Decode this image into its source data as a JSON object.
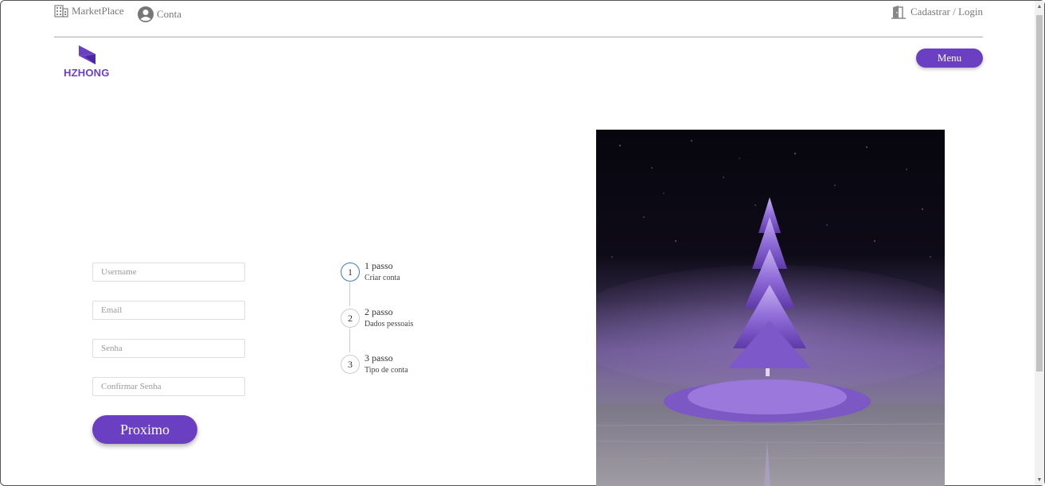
{
  "topbar": {
    "marketplace": "MarketPlace",
    "account": "Conta",
    "auth": "Cadastrar / Login"
  },
  "brand": {
    "name": "HZHONG",
    "color": "#6a3fc2"
  },
  "header": {
    "menu_label": "Menu"
  },
  "form": {
    "username_placeholder": "Username",
    "email_placeholder": "Email",
    "password_placeholder": "Senha",
    "confirm_placeholder": "Confirmar Senha",
    "next_label": "Proximo"
  },
  "steps": [
    {
      "number": "1",
      "title": "1 passo",
      "subtitle": "Criar conta",
      "active": true
    },
    {
      "number": "2",
      "title": "2 passo",
      "subtitle": "Dados pessoais",
      "active": false
    },
    {
      "number": "3",
      "title": "3 passo",
      "subtitle": "Tipo de conta",
      "active": false
    }
  ],
  "icons": {
    "marketplace": "building-icon",
    "account": "user-circle-icon",
    "auth": "door-icon"
  }
}
